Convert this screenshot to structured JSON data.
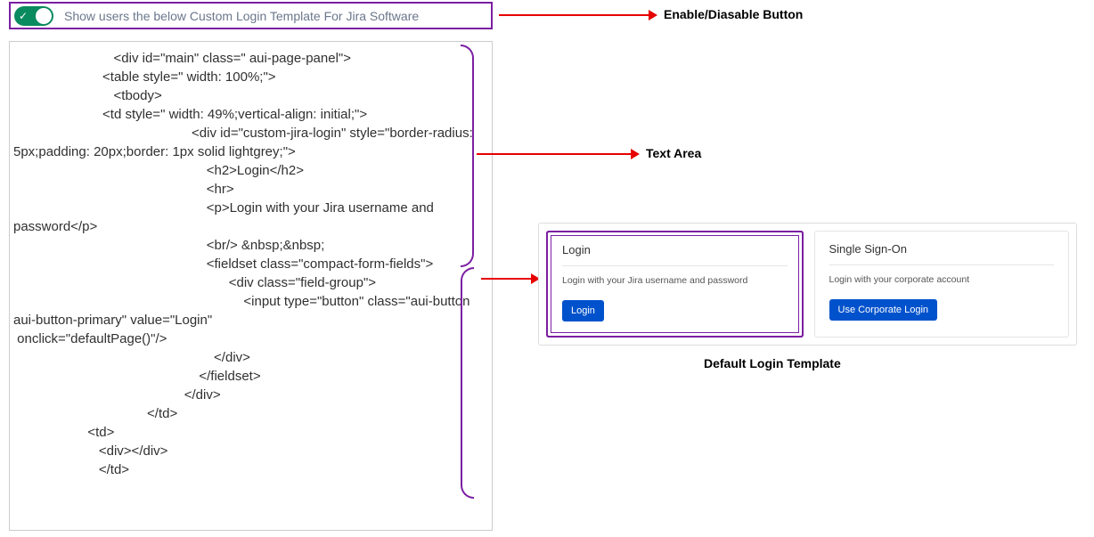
{
  "toggle": {
    "label": "Show users the below Custom Login Template For Jira Software",
    "enabled": true
  },
  "annotations": {
    "enable_disable": "Enable/Diasable Button",
    "text_area": "Text Area",
    "default_template": "Default Login Template"
  },
  "code_content": "                           <div id=\"main\" class=\" aui-page-panel\">\n                        <table style=\" width: 100%;\">\n                           <tbody>\n                        <td style=\" width: 49%;vertical-align: initial;\">\n                                                <div id=\"custom-jira-login\" style=\"border-radius: 5px;padding: 20px;border: 1px solid lightgrey;\">\n                                                    <h2>Login</h2>\n                                                    <hr>\n                                                    <p>Login with your Jira username and password</p>\n                                                    <br/> &nbsp;&nbsp;\n                                                    <fieldset class=\"compact-form-fields\">\n                                                          <div class=\"field-group\">\n                                                              <input type=\"button\" class=\"aui-button aui-button-primary\" value=\"Login\"\n onclick=\"defaultPage()\"/>\n                                                      </div>\n                                                  </fieldset>\n                                              </div>\n                                    </td>\n                    <td>\n                       <div></div>\n                       </td>",
  "preview": {
    "login_card": {
      "title": "Login",
      "description": "Login with your Jira username and password",
      "button": "Login"
    },
    "sso_card": {
      "title": "Single Sign-On",
      "description": "Login with your corporate account",
      "button": "Use Corporate Login"
    }
  }
}
